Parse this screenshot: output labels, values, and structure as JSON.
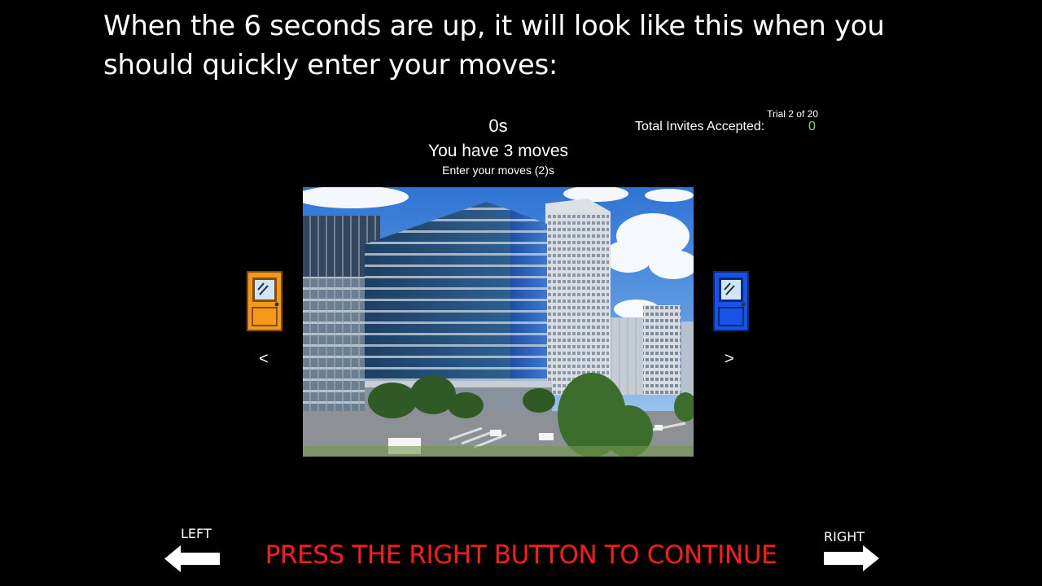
{
  "instruction": {
    "line1": "When the 6 seconds are up, it will look like this when you",
    "line2": "should quickly enter your moves:"
  },
  "game": {
    "timer": "0s",
    "moves_text": "You have 3 moves",
    "enter_text": "Enter your moves (2)s",
    "trial": "Trial 2 of 20",
    "invites_label": "Total Invites Accepted:",
    "invites_value": "0",
    "invites_value_color": "#7fd08a",
    "scene_image": "city office buildings with blue sky",
    "left_door": {
      "icon": "door-icon",
      "color": "#f39a1c",
      "nav": "<"
    },
    "right_door": {
      "icon": "door-icon",
      "color": "#1554e6",
      "nav": ">"
    }
  },
  "controls": {
    "left_label": "LEFT",
    "left_icon": "arrow-left-icon",
    "right_label": "RIGHT",
    "right_icon": "arrow-right-icon",
    "continue_text": "PRESS THE RIGHT BUTTON TO CONTINUE",
    "continue_color": "#ff1a1a"
  }
}
